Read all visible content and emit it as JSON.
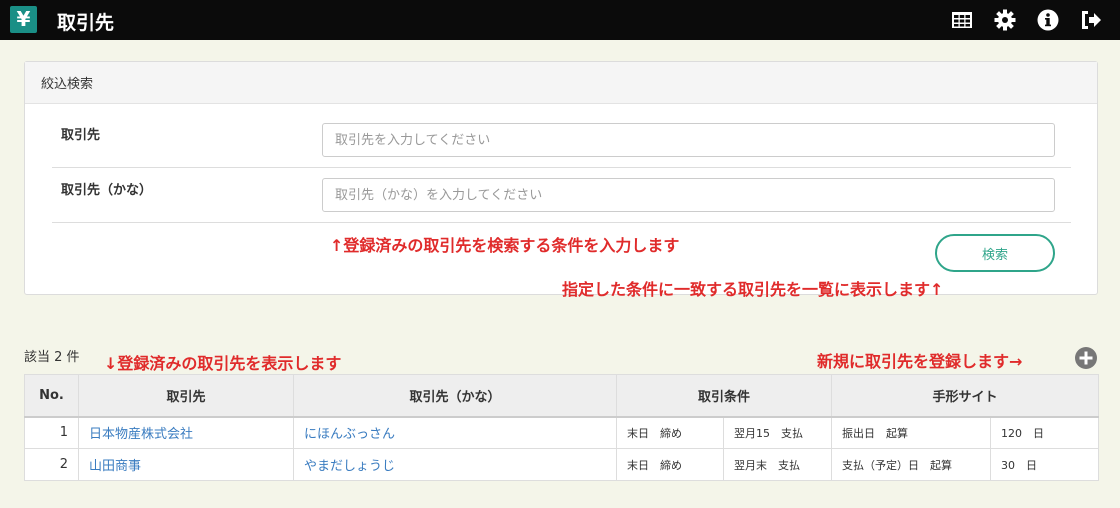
{
  "header": {
    "logo_symbol": "¥",
    "title": "取引先",
    "icons": [
      "table-icon",
      "gear-icon",
      "info-icon",
      "logout-icon"
    ]
  },
  "search_panel": {
    "heading": "絞込検索",
    "fields": [
      {
        "label": "取引先",
        "placeholder": "取引先を入力してください",
        "value": ""
      },
      {
        "label": "取引先（かな）",
        "placeholder": "取引先（かな）を入力してください",
        "value": ""
      }
    ],
    "button_label": "検索"
  },
  "annotations": {
    "search_hint": "↑登録済みの取引先を検索する条件を入力します",
    "button_hint": "指定した条件に一致する取引先を一覧に表示します↑",
    "list_hint": "↓登録済みの取引先を表示します",
    "add_hint": "新規に取引先を登録します→"
  },
  "results": {
    "count_label": "該当 2 件",
    "columns": [
      "No.",
      "取引先",
      "取引先（かな）",
      "取引条件",
      "手形サイト"
    ],
    "rows": [
      {
        "no": "1",
        "name": "日本物産株式会社",
        "kana": "にほんぶっさん",
        "cond_close": "末日　締め",
        "cond_pay": "翌月15　支払",
        "site_base": "振出日　起算",
        "site_days": "120　日"
      },
      {
        "no": "2",
        "name": "山田商事",
        "kana": "やまだしょうじ",
        "cond_close": "末日　締め",
        "cond_pay": "翌月末　支払",
        "site_base": "支払（予定）日　起算",
        "site_days": "30　日"
      }
    ]
  },
  "colors": {
    "accent": "#2fa58a",
    "logo_bg": "#1a8f86",
    "link": "#3a7cc0",
    "annotation": "#e02b2b",
    "topbar": "#0b0b0b"
  }
}
